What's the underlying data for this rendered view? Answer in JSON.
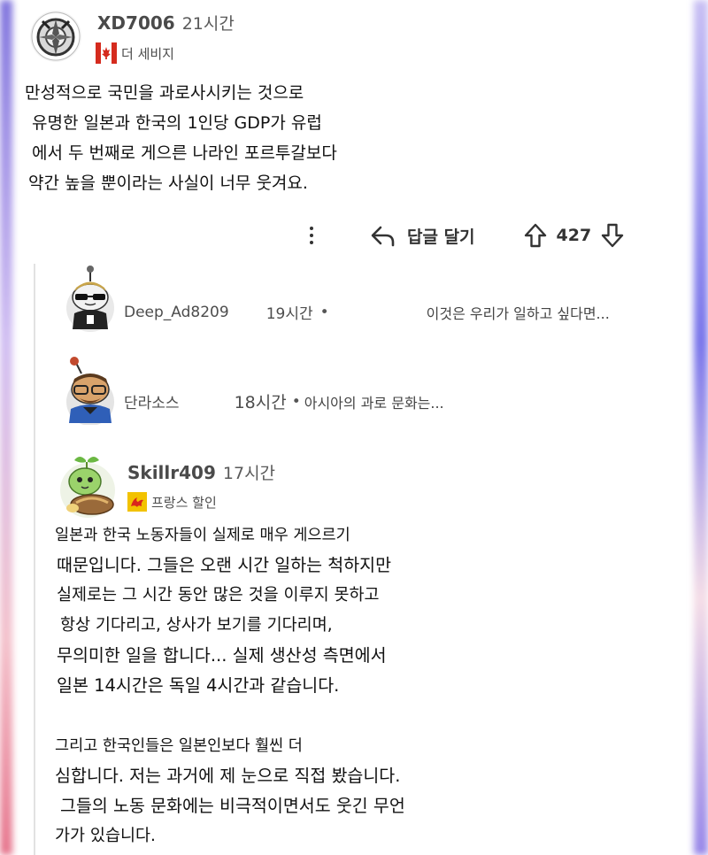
{
  "post": {
    "author": "XD7006",
    "time": "21시간",
    "flair_flag": "canada-flag-icon",
    "flair_text": "더 세비지",
    "body_lines": [
      "만성적으로 국민을 과로사시키는 것으로",
      "유명한 일본과 한국의 1인당 GDP가 유럽",
      "에서 두 번째로 게으른 나라인 포르투갈보다",
      "약간 높을 뿐이라는 사실이 너무 웃겨요."
    ],
    "actions": {
      "more_icon": "more-vertical-icon",
      "reply_icon": "reply-arrow-icon",
      "reply_label": "답글 달기",
      "upvote_icon": "arrow-up-icon",
      "vote_count": "427",
      "downvote_icon": "arrow-down-icon"
    }
  },
  "collapsed_replies": [
    {
      "author": "Deep_Ad8209",
      "time": "19시간",
      "separator": "•",
      "preview": "이것은 우리가 일하고 싶다면..."
    },
    {
      "author": "단라소스",
      "time": "18시간",
      "separator": "•",
      "preview": "아시아의 과로 문화는..."
    }
  ],
  "reply": {
    "author": "Skillr409",
    "time": "17시간",
    "flair_flag": "wallonia-flag-icon",
    "flair_text": "프랑스 할인",
    "paragraph1": [
      "일본과 한국 노동자들이 실제로 매우 게으르기",
      "때문입니다. 그들은 오랜 시간 일하는 척하지만",
      "실제로는 그 시간 동안 많은 것을 이루지 못하고",
      "항상 기다리고, 상사가 보기를 기다리며,",
      "무의미한 일을 합니다... 실제 생산성 측면에서",
      "일본 14시간은 독일 4시간과 같습니다."
    ],
    "paragraph2": [
      "그리고 한국인들은 일본인보다 훨씬 더",
      "심합니다. 저는 과거에 제 눈으로 직접 봤습니다.",
      "그들의 노동 문화에는 비극적이면서도 웃긴 무언",
      "가가 있습니다."
    ]
  },
  "colors": {
    "accent_edge_left": "#6a5cd8",
    "accent_edge_right": "#6a66e8",
    "canada_red": "#d52b1e",
    "wallonia_yellow": "#f2c200",
    "wallonia_red": "#d9261c"
  }
}
